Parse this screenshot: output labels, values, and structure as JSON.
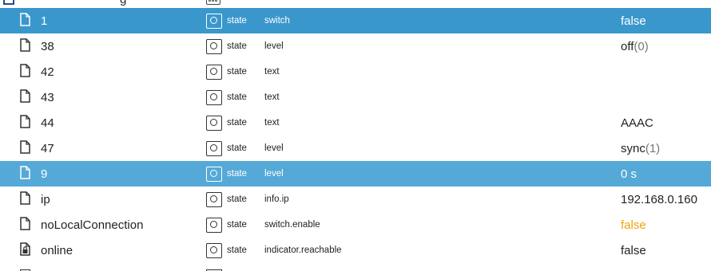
{
  "parent_row": {
    "partial_label": "g"
  },
  "colors": {
    "selected": "#3a97cc",
    "hover": "#55a9d7",
    "warning_value": "#f0a30a"
  },
  "rows": [
    {
      "icon": "file-icon",
      "name": "1",
      "type": "state",
      "role": "switch",
      "value": "false",
      "value_num": "",
      "state": "selected"
    },
    {
      "icon": "file-icon",
      "name": "38",
      "type": "state",
      "role": "level",
      "value": "off",
      "value_num": "(0)",
      "state": ""
    },
    {
      "icon": "file-icon",
      "name": "42",
      "type": "state",
      "role": "text",
      "value": "",
      "value_num": "",
      "state": ""
    },
    {
      "icon": "file-icon",
      "name": "43",
      "type": "state",
      "role": "text",
      "value": "",
      "value_num": "",
      "state": ""
    },
    {
      "icon": "file-icon",
      "name": "44",
      "type": "state",
      "role": "text",
      "value": "AAAC",
      "value_num": "",
      "state": ""
    },
    {
      "icon": "file-icon",
      "name": "47",
      "type": "state",
      "role": "level",
      "value": "sync",
      "value_num": "(1)",
      "state": ""
    },
    {
      "icon": "file-icon",
      "name": "9",
      "type": "state",
      "role": "level",
      "value": "0 s",
      "value_num": "",
      "state": "hover"
    },
    {
      "icon": "file-icon",
      "name": "ip",
      "type": "state",
      "role": "info.ip",
      "value": "192.168.0.160",
      "value_num": "",
      "state": ""
    },
    {
      "icon": "file-icon",
      "name": "noLocalConnection",
      "type": "state",
      "role": "switch.enable",
      "value": "false",
      "value_num": "",
      "state": "",
      "value_color": "orange"
    },
    {
      "icon": "lock-file-icon",
      "name": "online",
      "type": "state",
      "role": "indicator.reachable",
      "value": "false",
      "value_num": "",
      "state": ""
    }
  ]
}
